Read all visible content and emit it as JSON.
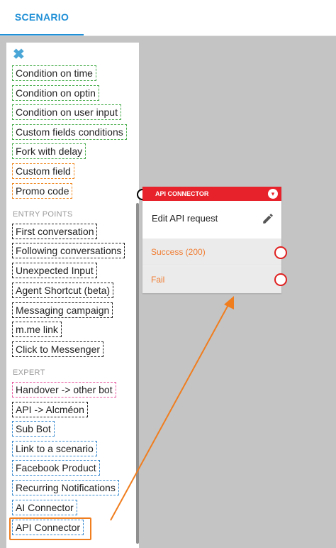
{
  "header": {
    "tab_label": "SCENARIO"
  },
  "sidebar": {
    "close_icon": "close-icon",
    "items_top": [
      {
        "label": "Condition on time",
        "style": "green"
      },
      {
        "label": "Condition on optin",
        "style": "green"
      },
      {
        "label": "Condition on user input",
        "style": "green"
      },
      {
        "label": "Custom fields conditions",
        "style": "green"
      },
      {
        "label": "Fork with delay",
        "style": "green"
      },
      {
        "label": "Custom field",
        "style": "orange"
      },
      {
        "label": "Promo code",
        "style": "orange"
      }
    ],
    "entry_points_heading": "ENTRY POINTS",
    "entry_points": [
      {
        "label": "First conversation"
      },
      {
        "label": "Following conversations"
      },
      {
        "label": "Unexpected Input"
      },
      {
        "label": "Agent Shortcut (beta)"
      },
      {
        "label": "Messaging campaign"
      },
      {
        "label": "m.me link"
      },
      {
        "label": "Click to Messenger"
      }
    ],
    "expert_heading": "EXPERT",
    "expert": [
      {
        "label": "Handover -> other bot",
        "style": "pink"
      },
      {
        "label": "API -> Alcméon",
        "style": "black"
      },
      {
        "label": "Sub Bot",
        "style": "blue"
      },
      {
        "label": "Link to a scenario",
        "style": "blue"
      },
      {
        "label": "Facebook Product",
        "style": "blue"
      },
      {
        "label": "Recurring Notifications",
        "style": "blue"
      },
      {
        "label": "AI Connector",
        "style": "blue"
      },
      {
        "label": "API Connector",
        "style": "blue"
      }
    ]
  },
  "node": {
    "title": "API CONNECTOR",
    "body_label": "Edit API request",
    "outputs": [
      "Success (200)",
      "Fail"
    ],
    "toggle_icon": "chevron-down-icon"
  },
  "colors": {
    "accent": "#1f8fd6",
    "node_header": "#e8222a",
    "annotation": "#f07d1e",
    "output_text": "#f07d32"
  }
}
